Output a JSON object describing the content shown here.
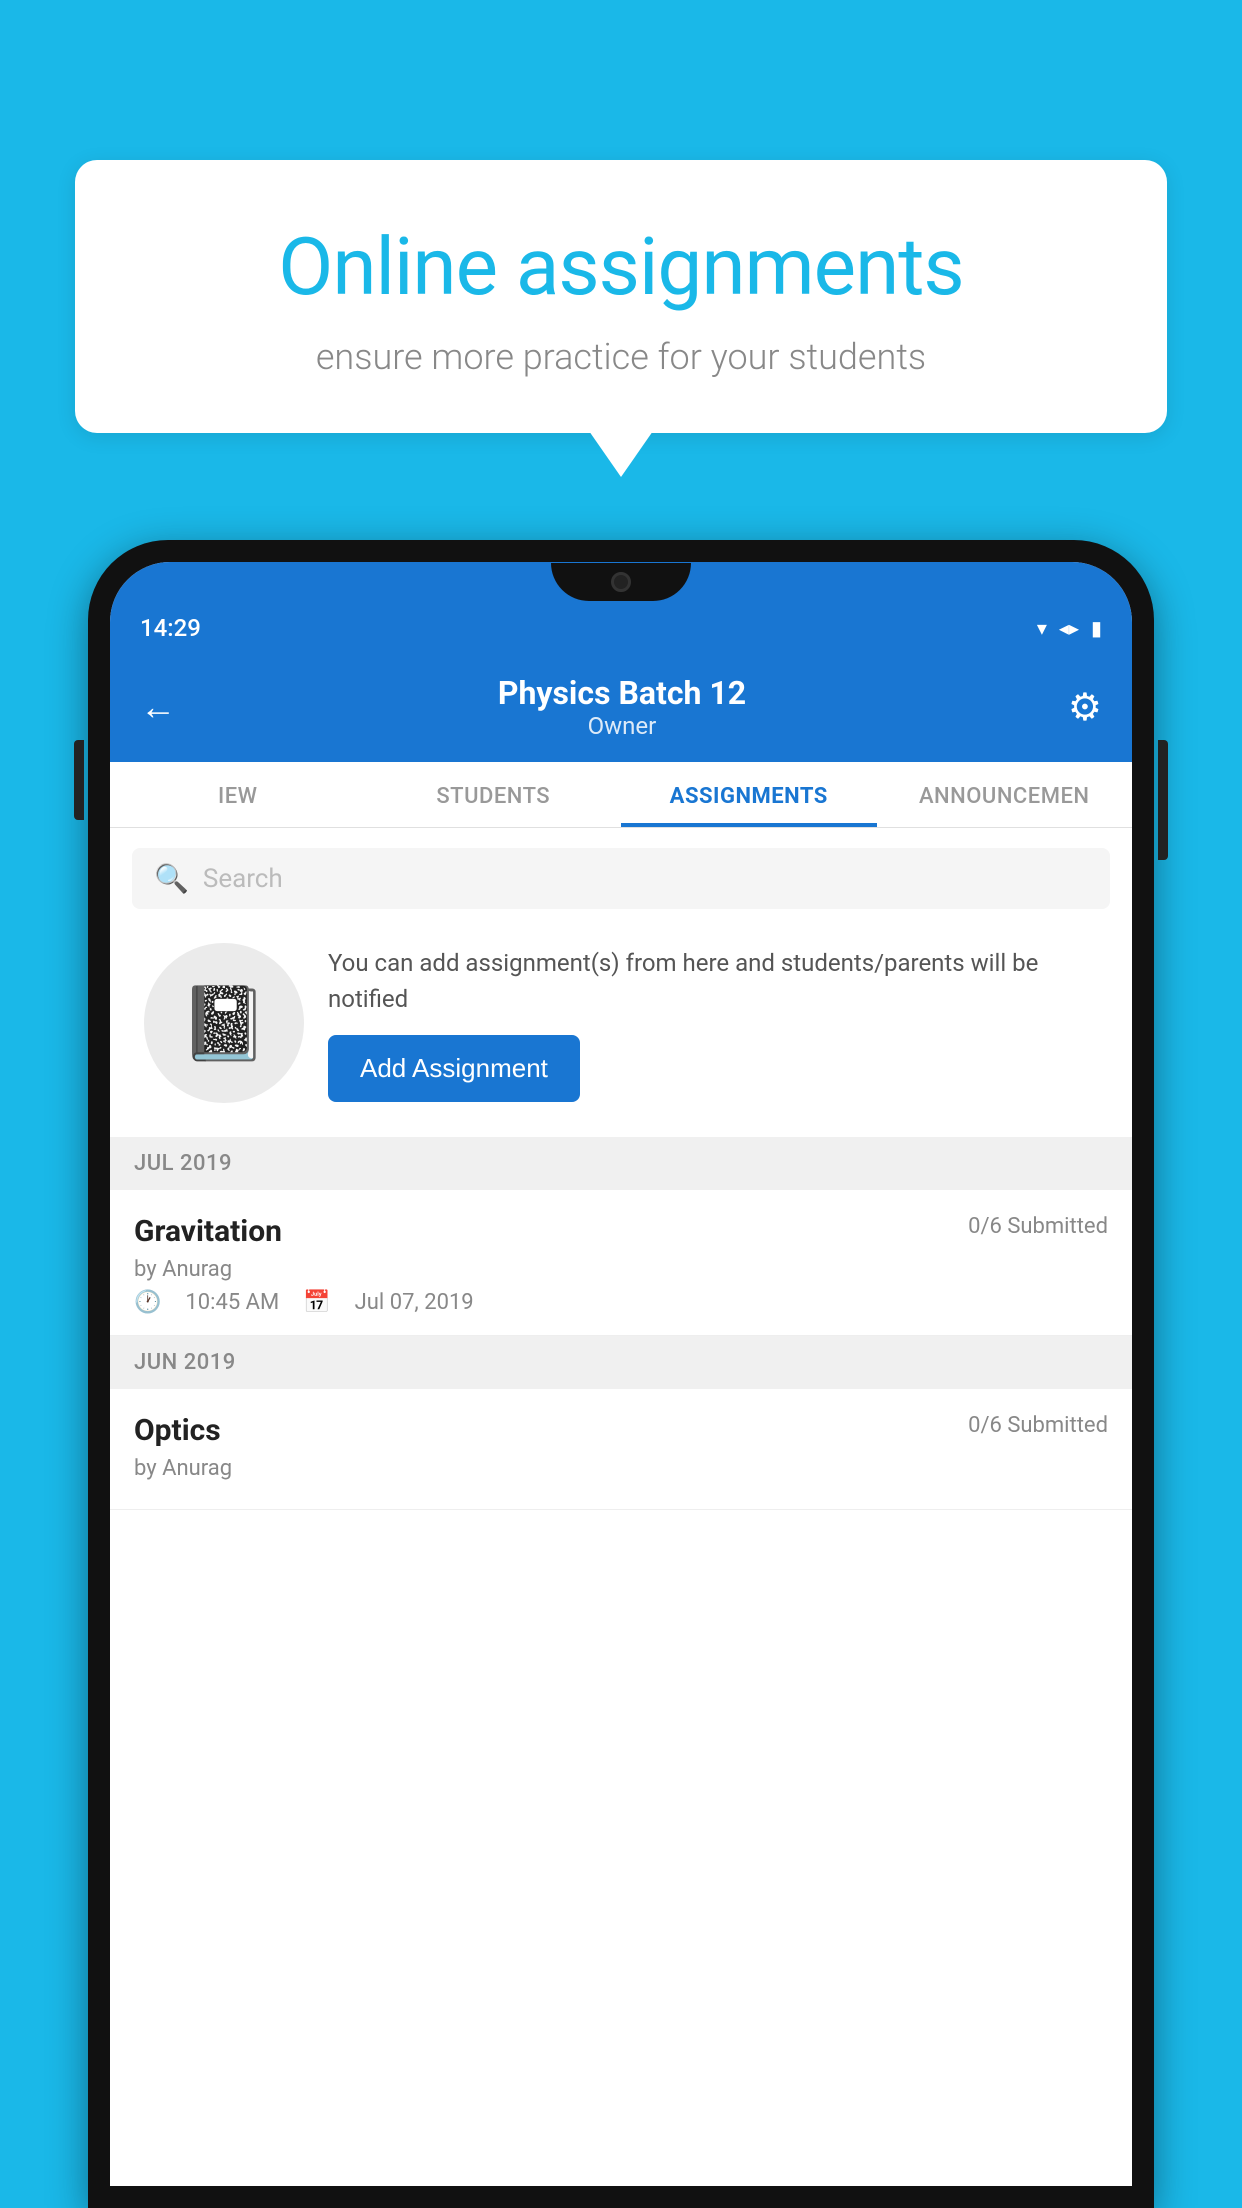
{
  "background_color": "#1ab8e8",
  "speech_bubble": {
    "title": "Online assignments",
    "subtitle": "ensure more practice for your students"
  },
  "status_bar": {
    "time": "14:29",
    "icons": [
      "wifi",
      "signal",
      "battery"
    ]
  },
  "app_header": {
    "back_label": "←",
    "batch_name": "Physics Batch 12",
    "owner_label": "Owner",
    "gear_icon": "⚙"
  },
  "tabs": [
    {
      "label": "IEW",
      "active": false
    },
    {
      "label": "STUDENTS",
      "active": false
    },
    {
      "label": "ASSIGNMENTS",
      "active": true
    },
    {
      "label": "ANNOUNCEMEN",
      "active": false
    }
  ],
  "search": {
    "placeholder": "Search"
  },
  "promo": {
    "description": "You can add assignment(s) from here and students/parents will be notified",
    "button_label": "Add Assignment"
  },
  "sections": [
    {
      "month": "JUL 2019",
      "assignments": [
        {
          "name": "Gravitation",
          "submitted": "0/6 Submitted",
          "by": "by Anurag",
          "time": "10:45 AM",
          "date": "Jul 07, 2019"
        }
      ]
    },
    {
      "month": "JUN 2019",
      "assignments": [
        {
          "name": "Optics",
          "submitted": "0/6 Submitted",
          "by": "by Anurag",
          "time": "",
          "date": ""
        }
      ]
    }
  ]
}
